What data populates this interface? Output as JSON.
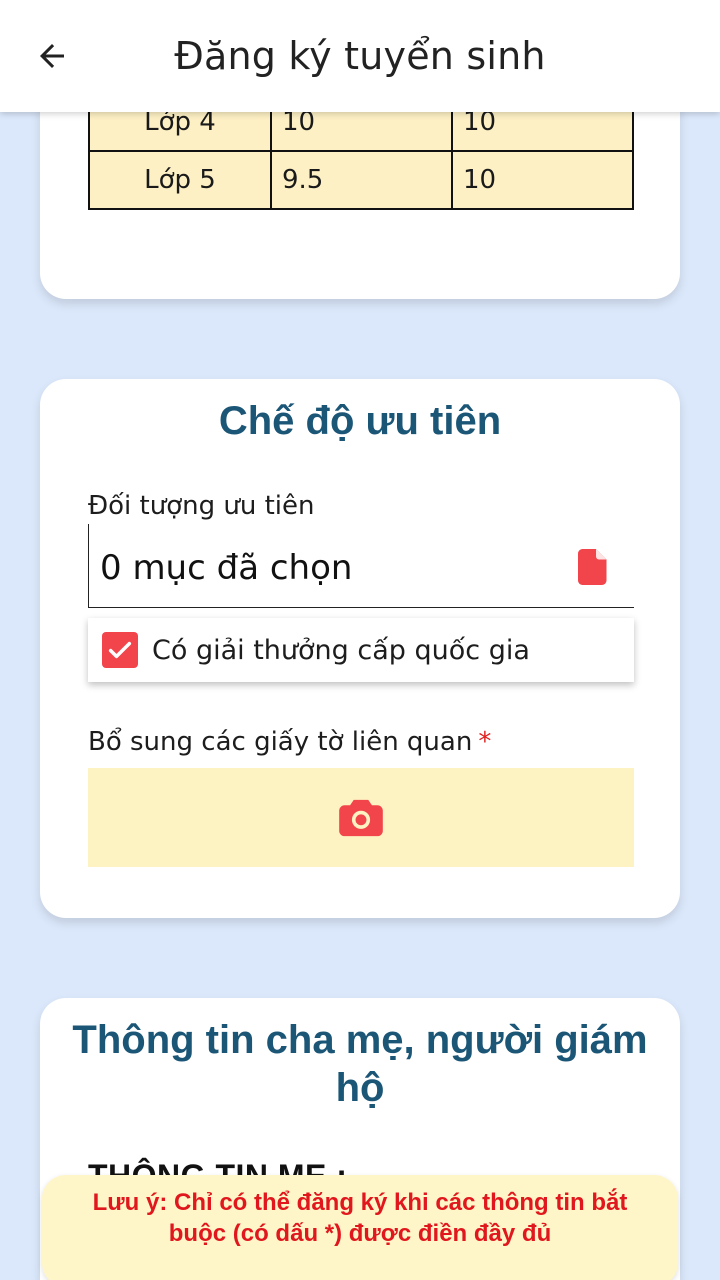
{
  "header": {
    "title": "Đăng ký tuyển sinh",
    "back_icon": "arrow-left-icon"
  },
  "grades_table": {
    "rows": [
      {
        "grade": "Lớp 4",
        "score1": "10",
        "score2": "10"
      },
      {
        "grade": "Lớp 5",
        "score1": "9.5",
        "score2": "10"
      }
    ]
  },
  "priority_section": {
    "title": "Chế độ ưu tiên",
    "priority_label": "Đối tượng ưu tiên",
    "priority_value": "0 mục đã chọn",
    "priority_icon": "file-icon",
    "checkbox_label": "Có giải thưởng cấp quốc gia",
    "checkbox_checked": true,
    "documents_label": "Bổ sung các giấy tờ liên quan",
    "required_mark": "*",
    "camera_icon": "camera-icon"
  },
  "parents_section": {
    "title": "Thông tin cha mẹ, người giám hộ",
    "mother_heading": "THÔNG TIN MẸ :"
  },
  "toast": {
    "message": "Lưu ý: Chỉ có thể đăng ký khi các thông tin bắt buộc (có dấu *) được điền đầy đủ"
  },
  "colors": {
    "background": "#dbe8fb",
    "accent_red": "#f2444b",
    "title_blue": "#1b5677",
    "table_fill": "#fdf0c4",
    "upload_fill": "#fdf3c2",
    "toast_fill": "#fef6c8"
  }
}
